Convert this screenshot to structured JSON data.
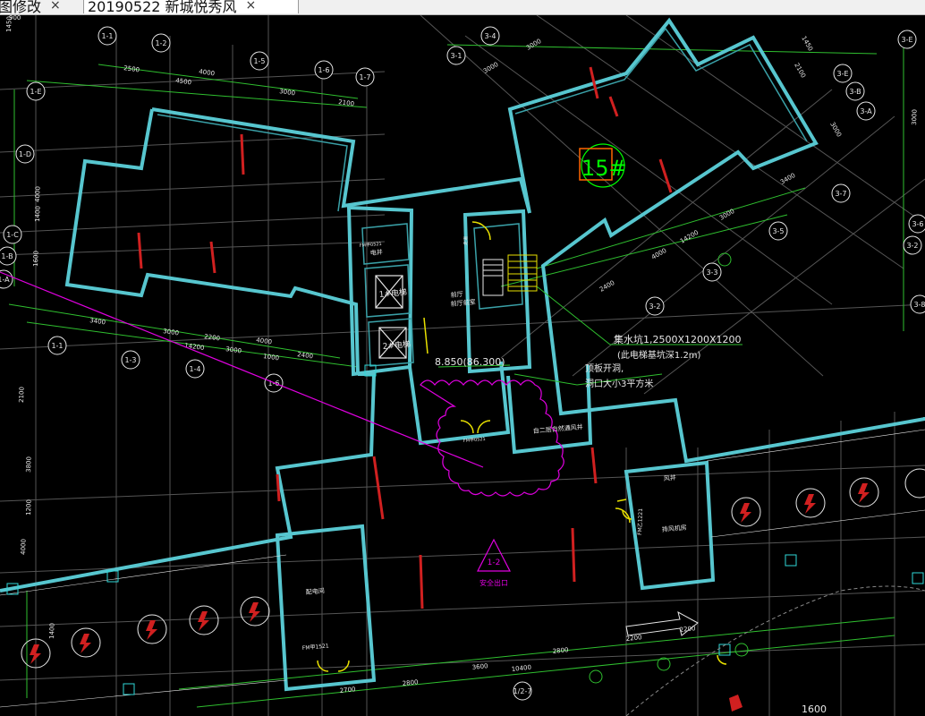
{
  "tabs": [
    {
      "label": "图修改",
      "close": "×"
    },
    {
      "label": "20190522 新城悦秀风",
      "close": "×"
    }
  ],
  "axes": [
    "1-1",
    "1-2",
    "1-5",
    "1-6",
    "1-7",
    "1-E",
    "1-D",
    "1-C",
    "1-B",
    "1-A",
    "1-1",
    "1-3",
    "1-4",
    "1-6",
    "3-1",
    "3-2",
    "3-3",
    "3-5",
    "3-6",
    "3-7",
    "3-A",
    "3-B",
    "3-E",
    "3-E",
    "3-8",
    "1/2-7",
    "3-4",
    "3-2"
  ],
  "dims": [
    "2500",
    "4000",
    "4500",
    "3000",
    "2100",
    "3000",
    "2200",
    "4000",
    "3000",
    "14200",
    "3400",
    "1000",
    "2400",
    "1400",
    "1600",
    "4000",
    "3000",
    "3000",
    "3400",
    "3000",
    "4000",
    "2400",
    "14200",
    "3000",
    "2100",
    "1450",
    "900",
    "2100",
    "3600",
    "10400",
    "2800",
    "2700",
    "2800",
    "2200",
    "2200",
    "4000",
    "1400",
    "1200",
    "3800",
    "1450",
    "3000",
    "1600"
  ],
  "marker": {
    "label": "15#",
    "color": "#00ff00",
    "frame": "#ff6600"
  },
  "annotations": {
    "pit": "集水坑1,2500X1200X1200",
    "pit_note": "(此电梯基坑深1.2m)",
    "roof_hole_1": "顶板开洞,",
    "roof_hole_2": "洞口大小3平方米",
    "level": "8.850(86.300)",
    "exit_mark": "1-2",
    "exit_label": "安全出口"
  },
  "rooms": {
    "hall": "前厅",
    "hall2": "前厅前室",
    "elev1": "1#电梯",
    "elev2": "2#电梯",
    "corridor": "走道",
    "room_ef": "电井",
    "fan": "风井",
    "fan_room": "排风机房",
    "pump": "配电间",
    "lobby": "自二层自然通风井",
    "door1": "FM甲0521",
    "door2": "FM甲0521",
    "door3": "FM甲1521",
    "door4": "FM乙1221"
  },
  "colors": {
    "cyan": "#57c6cf",
    "grid": "#5a5a5a",
    "yellow": "#e8e000",
    "magenta": "#e000e0",
    "green": "#00cc00",
    "red": "#d02020",
    "white": "#e8e8e8"
  }
}
